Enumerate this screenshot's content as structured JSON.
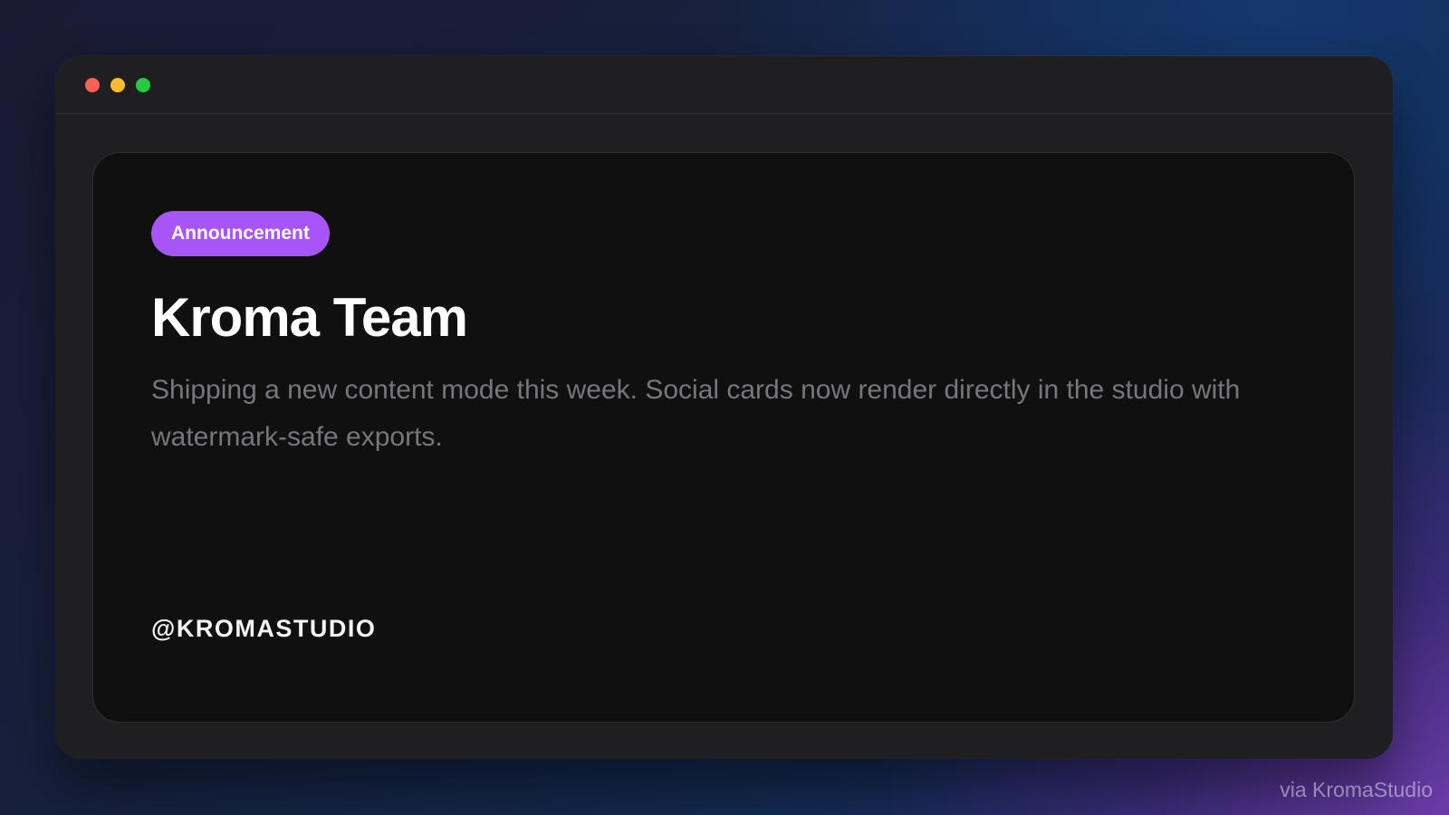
{
  "window": {
    "controls": [
      {
        "name": "close",
        "color": "#ff5f57"
      },
      {
        "name": "minimize",
        "color": "#febc2e"
      },
      {
        "name": "maximize",
        "color": "#28c840"
      }
    ]
  },
  "card": {
    "badge": {
      "label": "Announcement",
      "color": "#a855f7"
    },
    "title": "Kroma Team",
    "body": "Shipping a new content mode this week. Social cards now render directly in the studio with watermark-safe exports.",
    "handle": "@KROMASTUDIO"
  },
  "watermark": "via KromaStudio"
}
